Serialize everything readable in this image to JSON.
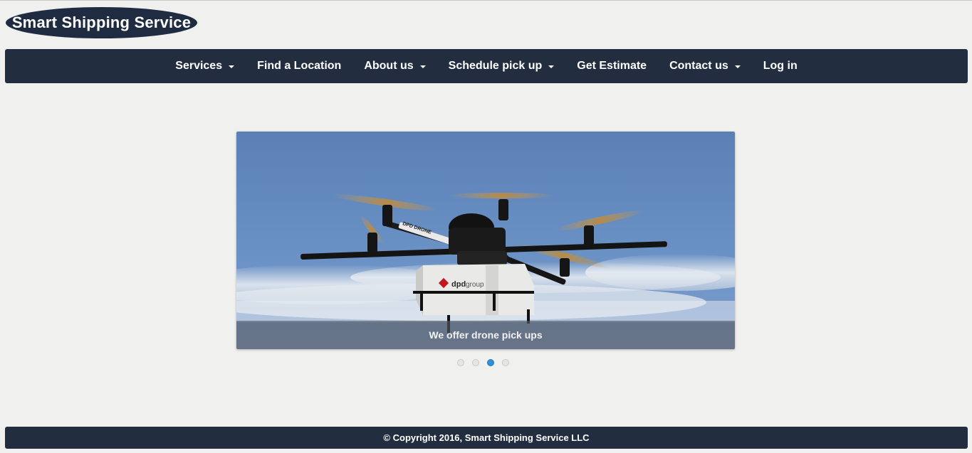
{
  "logo": {
    "text": "Smart Shipping Service"
  },
  "nav": {
    "items": [
      {
        "label": "Services",
        "dropdown": true
      },
      {
        "label": "Find a Location",
        "dropdown": false
      },
      {
        "label": "About us",
        "dropdown": true
      },
      {
        "label": "Schedule pick up",
        "dropdown": true
      },
      {
        "label": "Get Estimate",
        "dropdown": false
      },
      {
        "label": "Contact us",
        "dropdown": true
      },
      {
        "label": "Log in",
        "dropdown": false
      }
    ]
  },
  "carousel": {
    "caption": "We offer drone pick ups",
    "image_alt": "Delivery drone carrying a dpd group parcel box",
    "box_brand": "dpd",
    "box_brand_suffix": "group",
    "arm_label": "DPD DRONE",
    "slide_count": 4,
    "active_index": 2,
    "active_color": "#2f8fd8"
  },
  "footer": {
    "text": "© Copyright 2016, Smart Shipping Service LLC"
  },
  "colors": {
    "nav_bg": "#222e40",
    "logo_bg": "#1f2b40",
    "page_bg": "#f0f0ef"
  }
}
